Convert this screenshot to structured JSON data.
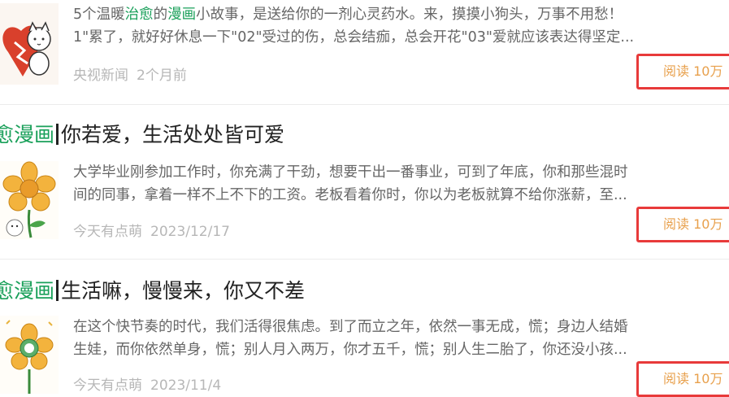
{
  "articles": [
    {
      "summary_line1_pre": "5个温暖",
      "summary_line1_hl1": "治愈",
      "summary_line1_mid": "的",
      "summary_line1_hl2": "漫画",
      "summary_line1_post": "小故事，是送给你的一剂心灵药水。来，摸摸小狗头，万事不用愁！",
      "summary_line2": "1\"累了，就好好休息一下\"02\"受过的伤，总会结痂，总会开花\"03\"爱就应该表达得坚定...",
      "source": "央视新闻",
      "time": "2个月前",
      "read_label": "阅读 10万"
    },
    {
      "title_tag": "愈漫画",
      "title_text": "你若爱，生活处处皆可爱",
      "summary_line1": "大学毕业刚参加工作时，你充满了干劲，想要干出一番事业，可到了年底，你和那些混时",
      "summary_line2": "间的同事，拿着一样不上不下的工资。老板看着你时，你以为老板就算不给你涨薪，至...",
      "source": "今天有点萌",
      "time": "2023/12/17",
      "read_label": "阅读 10万"
    },
    {
      "title_tag": "愈漫画",
      "title_text": "生活嘛，慢慢来，你又不差",
      "summary_line1": "在这个快节奏的时代，我们活得很焦虑。到了而立之年，依然一事无成，慌；身边人结婚",
      "summary_line2": "生娃，而你依然单身，慌；别人月入两万，你才五千，慌；别人生二胎了，你还没小孩...",
      "source": "今天有点萌",
      "time": "2023/11/4",
      "read_label": "阅读 10万"
    }
  ],
  "colors": {
    "accent_green": "#1aa05a",
    "read_border": "#e83a3a",
    "read_text": "#e8a04c"
  }
}
